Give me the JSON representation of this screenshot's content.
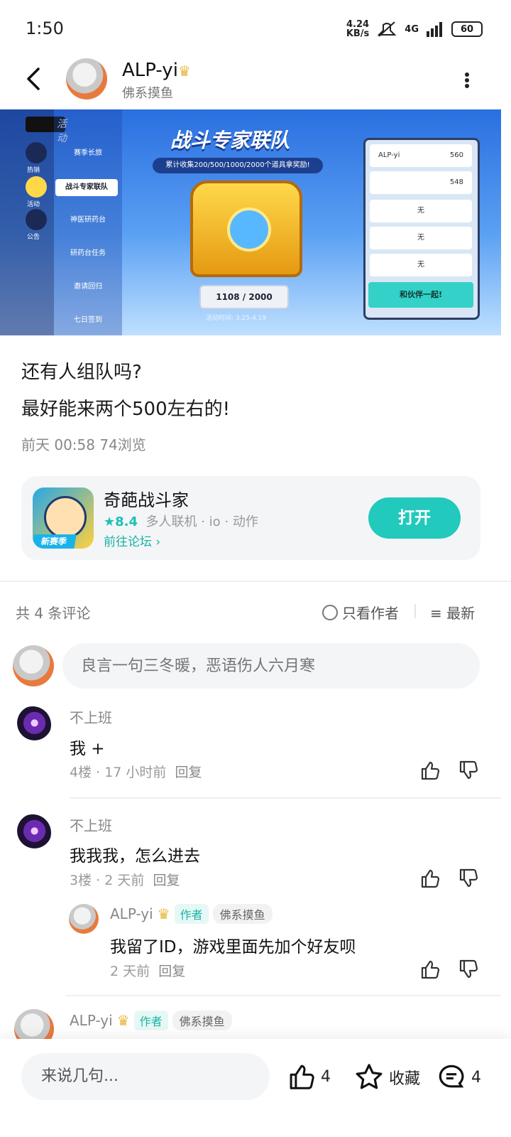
{
  "status": {
    "time": "1:50",
    "net_speed": "4.24",
    "net_unit": "KB/s",
    "network": "4G",
    "battery": "60"
  },
  "header": {
    "username": "ALP-yi",
    "subtitle": "佛系摸鱼"
  },
  "banner": {
    "tab_label": "活动",
    "side_items": [
      "热销",
      "活动",
      "公告"
    ],
    "menu_items": [
      "赛季长旅",
      "战斗专家联队",
      "神医研药台",
      "研药台任务",
      "邀请回归",
      "七日签到"
    ],
    "title": "战斗专家联队",
    "tip": "累计收集200/500/1000/2000个道具拿奖励!",
    "progress": "1108 / 2000",
    "date": "活动时间: 3.25-4.19",
    "panel_rows": [
      {
        "name": "ALP-yi",
        "score": "560"
      },
      {
        "name": "",
        "score": "548"
      },
      {
        "name": "无",
        "score": ""
      },
      {
        "name": "无",
        "score": ""
      },
      {
        "name": "无",
        "score": ""
      }
    ],
    "panel_button": "和伙伴一起!"
  },
  "post": {
    "title": "还有人组队吗?",
    "body": "最好能来两个500左右的!",
    "meta": "前天 00:58  74浏览"
  },
  "game": {
    "name": "奇葩战斗家",
    "rating": "8.4",
    "tags": "多人联机 · io · 动作",
    "link": "前往论坛",
    "open": "打开",
    "icon_tag": "新赛季"
  },
  "comments_header": {
    "count": "共 4 条评论",
    "only_author": "只看作者",
    "sort": "最新"
  },
  "comment_input": {
    "placeholder": "良言一句三冬暖，恶语伤人六月寒"
  },
  "comments": [
    {
      "name": "不上班",
      "text": "我 +",
      "meta": "4楼 · 17 小时前",
      "reply": "回复"
    },
    {
      "name": "不上班",
      "text": "我我我，怎么进去",
      "meta": "3楼 · 2 天前",
      "reply": "回复"
    }
  ],
  "sub_reply": {
    "name": "ALP-yi",
    "author_tag": "作者",
    "title_tag": "佛系摸鱼",
    "text": "我留了ID，游戏里面先加个好友呗",
    "meta": "2 天前",
    "reply": "回复"
  },
  "partial_comment": {
    "name": "ALP-yi",
    "author_tag": "作者",
    "title_tag": "佛系摸鱼"
  },
  "bottom_bar": {
    "input_placeholder": "来说几句...",
    "likes": "4",
    "collect": "收藏",
    "comments": "4"
  }
}
